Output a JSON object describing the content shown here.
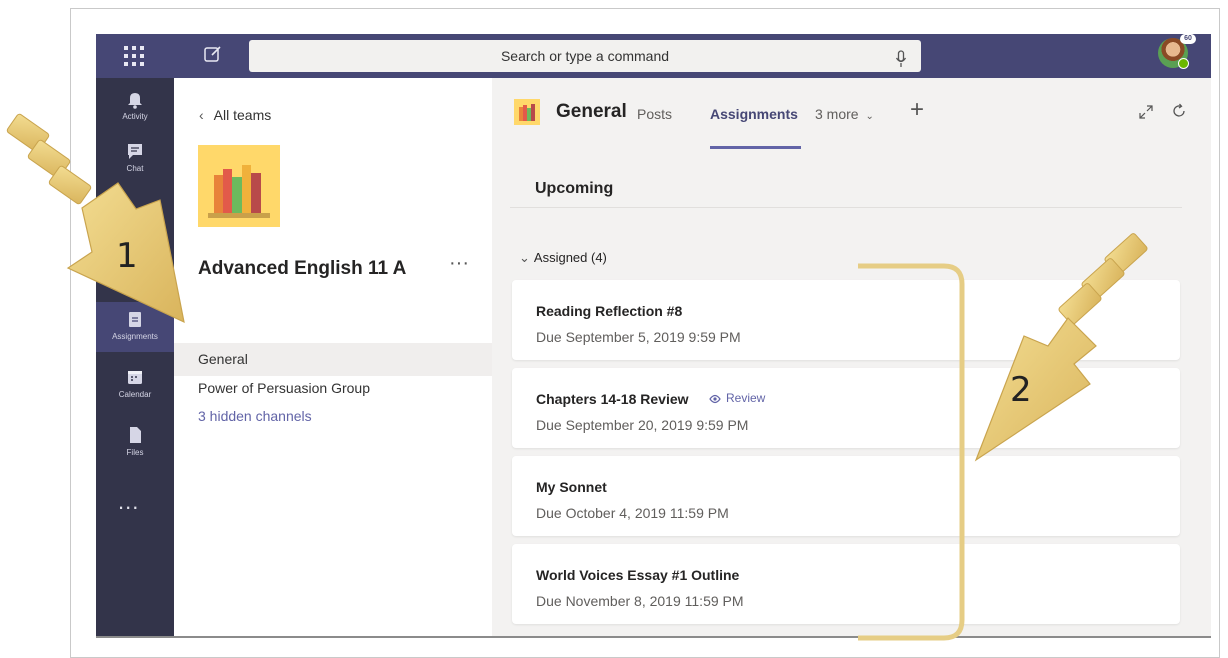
{
  "topbar": {
    "search_placeholder": "Search or type a command",
    "avatar_badge": "60"
  },
  "rail": {
    "items": [
      {
        "label": "Activity",
        "icon": "bell-icon"
      },
      {
        "label": "Chat",
        "icon": "chat-icon"
      },
      {
        "label": "Assignments",
        "icon": "assignments-icon"
      },
      {
        "label": "Calendar",
        "icon": "calendar-icon"
      },
      {
        "label": "Files",
        "icon": "files-icon"
      }
    ],
    "more": "..."
  },
  "panel": {
    "back_label": "All teams",
    "team_name": "Advanced English 11 A",
    "more": "···",
    "channels": [
      {
        "label": "General"
      },
      {
        "label": "Power of Persuasion Group"
      },
      {
        "label": "3 hidden channels"
      }
    ]
  },
  "main": {
    "channel_title": "General",
    "tabs": [
      {
        "label": "Posts"
      },
      {
        "label": "Assignments"
      },
      {
        "label": "3 more"
      }
    ],
    "plus": "+",
    "section_title": "Upcoming",
    "group_label": "Assigned (4)",
    "assignments": [
      {
        "title": "Reading Reflection #8",
        "due": "Due September 5, 2019 9:59 PM"
      },
      {
        "title": "Chapters 14-18 Review",
        "due": "Due September 20, 2019 9:59 PM",
        "badge": "Review"
      },
      {
        "title": "My Sonnet",
        "due": "Due October 4, 2019 11:59 PM"
      },
      {
        "title": "World Voices Essay #1 Outline",
        "due": "Due November 8, 2019 11:59 PM"
      }
    ]
  },
  "annotations": {
    "callout_1": "1",
    "callout_2": "2"
  },
  "colors": {
    "topbar": "#464775",
    "rail": "#33344a",
    "accent": "#6264a7",
    "arrow_fill": "#e8cf7a",
    "team_tile": "#ffd86a"
  }
}
